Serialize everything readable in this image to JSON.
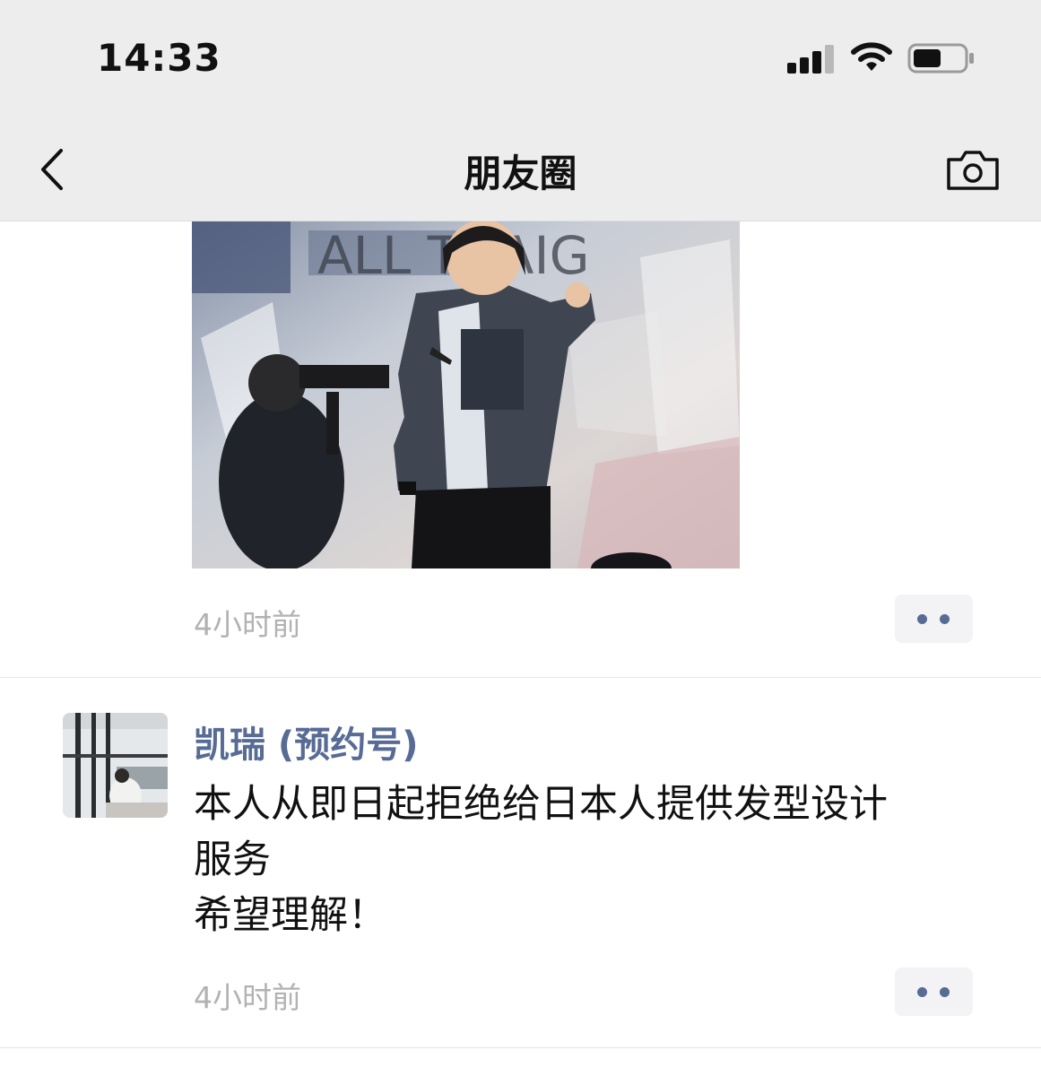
{
  "status_bar": {
    "time": "14:33"
  },
  "nav": {
    "title": "朋友圈"
  },
  "posts": [
    {
      "time_ago": "4小时前"
    },
    {
      "username": "凯瑞 (预约号)",
      "text_lines": [
        "本人从即日起拒绝给日本人提供发型设计",
        "服务",
        "希望理解！"
      ],
      "time_ago": "4小时前"
    }
  ],
  "photo_overlay_text": "ALL THAIG",
  "colors": {
    "link": "#576b95",
    "nav_bg": "#ededed",
    "muted": "#b2b2b2"
  }
}
